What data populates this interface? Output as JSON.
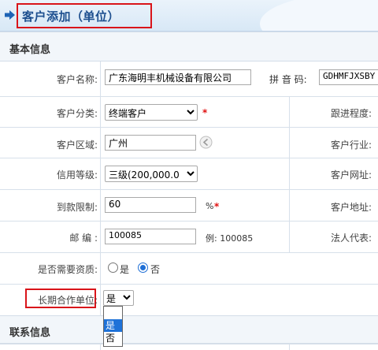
{
  "header": {
    "title": "客户添加（单位）"
  },
  "sections": {
    "basic": "基本信息",
    "contact": "联系信息"
  },
  "fields": {
    "name": {
      "label": "客户名称:",
      "value": "广东海明丰机械设备有限公司"
    },
    "pinyin": {
      "label": "拼 音 码:",
      "value": "GDHMFJXSBY"
    },
    "category": {
      "label": "客户分类:",
      "value": "终端客户",
      "required": "*"
    },
    "region": {
      "label": "客户区域:",
      "value": "广州"
    },
    "credit": {
      "label": "信用等级:",
      "value": "三级(200,000.0"
    },
    "limit": {
      "label": "到款限制:",
      "value": "60",
      "unit": "%",
      "required": "*"
    },
    "postcode": {
      "label": "邮 编 :",
      "value": "100085",
      "example": "例: 100085"
    },
    "qualify": {
      "label": "是否需要资质:",
      "options": [
        "是",
        "否"
      ],
      "selected": "否"
    },
    "longterm": {
      "label": "长期合作单位:",
      "value": "是",
      "options": [
        "",
        "是",
        "否"
      ],
      "highlighted": "是"
    }
  },
  "right_labels": {
    "follow": "跟进程度:",
    "industry": "客户行业:",
    "website": "客户网址:",
    "address": "客户地址:",
    "legal": "法人代表:"
  },
  "colors": {
    "accent": "#1d4f8f",
    "highlight_border": "#d9141a",
    "required": "#e01010",
    "selection": "#1e72d8"
  }
}
